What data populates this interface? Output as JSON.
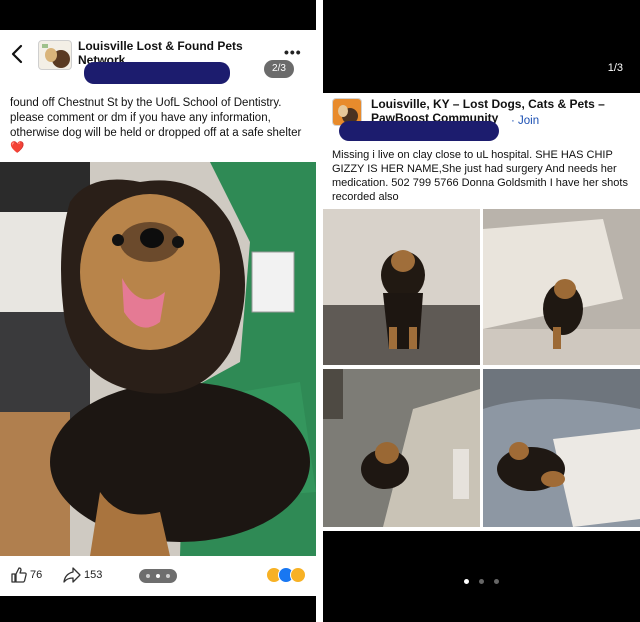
{
  "left_panel": {
    "group_name": "Louisville Lost & Found Pets",
    "group_name_line2": "Network",
    "photo_counter": "2/3",
    "post_text": "found off Chestnut St by the UofL School of Dentistry. please comment or dm if you have any information, otherwise dog will be held or dropped off at a safe shelter",
    "heart_emoji": "❤️",
    "like_count": "76",
    "share_count": "153",
    "reaction_colors": [
      "#f7b125",
      "#1877f2",
      "#f7b125"
    ]
  },
  "right_panel": {
    "slide_counter": "1/3",
    "group_name": "Louisville, KY – Lost Dogs, Cats & Pets –",
    "group_name_line2": "PawBoost Community",
    "join_label": "· Join",
    "post_text": "Missing i live on clay close to uL hospital. SHE HAS CHIP GIZZY IS HER NAME,She just had surgery And needs her medication. 502 799 5766 Donna Goldsmith I have her shots recorded also",
    "active_page_index": 0,
    "page_count": 3
  },
  "colors": {
    "redaction": "#1c1c6e",
    "link_blue": "#1a4fb3",
    "pill_gray": "#6b6b6b"
  }
}
